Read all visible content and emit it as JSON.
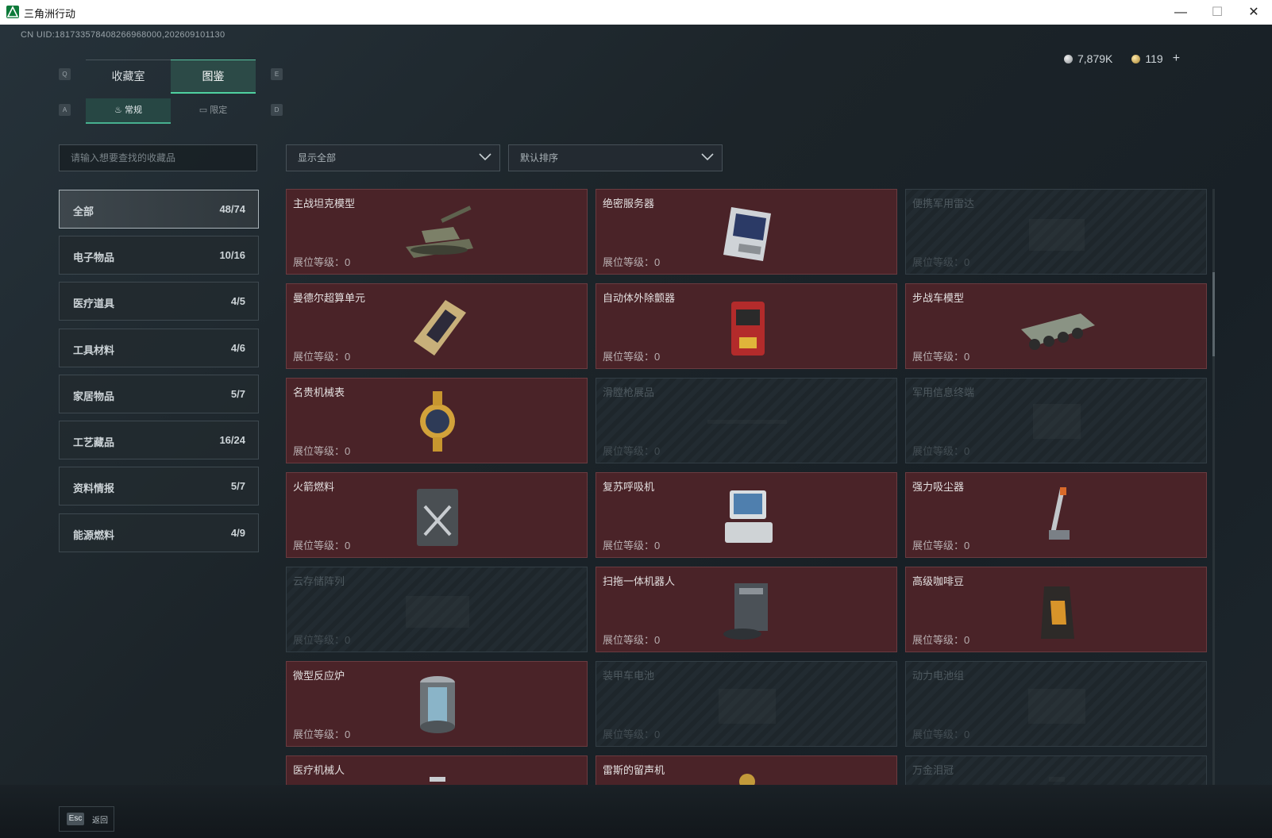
{
  "window": {
    "title": "三角洲行动",
    "min": "—",
    "max": "☐",
    "close": "✕"
  },
  "uid": "CN UID:181733578408266968000,202609101130",
  "currency": {
    "silver": "7,879K",
    "gold": "119",
    "plus": "+"
  },
  "tabs": {
    "key_left": "Q",
    "key_right": "E",
    "collection": "收藏室",
    "atlas": "图鉴"
  },
  "subtabs": {
    "key_left": "A",
    "key_right": "D",
    "normal": "常规",
    "limited": "限定"
  },
  "search": {
    "placeholder": "请输入想要查找的收藏品"
  },
  "filters": {
    "show": "显示全部",
    "sort": "默认排序"
  },
  "categories": [
    {
      "label": "全部",
      "count": "48/74"
    },
    {
      "label": "电子物品",
      "count": "10/16"
    },
    {
      "label": "医疗道具",
      "count": "4/5"
    },
    {
      "label": "工具材料",
      "count": "4/6"
    },
    {
      "label": "家居物品",
      "count": "5/7"
    },
    {
      "label": "工艺藏品",
      "count": "16/24"
    },
    {
      "label": "资料情报",
      "count": "5/7"
    },
    {
      "label": "能源燃料",
      "count": "4/9"
    }
  ],
  "level_label": "展位等级：",
  "level_value": "0",
  "items": [
    {
      "name": "主战坦克模型",
      "owned": true,
      "icon": "tank-icon"
    },
    {
      "name": "绝密服务器",
      "owned": true,
      "icon": "server-icon"
    },
    {
      "name": "便携军用雷达",
      "owned": false,
      "icon": "radar-icon"
    },
    {
      "name": "曼德尔超算单元",
      "owned": true,
      "icon": "chip-icon"
    },
    {
      "name": "自动体外除颤器",
      "owned": true,
      "icon": "defibrillator-icon"
    },
    {
      "name": "步战车模型",
      "owned": true,
      "icon": "ifv-icon"
    },
    {
      "name": "名贵机械表",
      "owned": true,
      "icon": "watch-icon"
    },
    {
      "name": "滑膛枪展品",
      "owned": false,
      "icon": "musket-icon"
    },
    {
      "name": "军用信息终端",
      "owned": false,
      "icon": "terminal-icon"
    },
    {
      "name": "火箭燃料",
      "owned": true,
      "icon": "fuel-can-icon"
    },
    {
      "name": "复苏呼吸机",
      "owned": true,
      "icon": "ventilator-icon"
    },
    {
      "name": "强力吸尘器",
      "owned": true,
      "icon": "vacuum-icon"
    },
    {
      "name": "云存储阵列",
      "owned": false,
      "icon": "storage-array-icon"
    },
    {
      "name": "扫拖一体机器人",
      "owned": true,
      "icon": "robot-vacuum-icon"
    },
    {
      "name": "高级咖啡豆",
      "owned": true,
      "icon": "coffee-bag-icon"
    },
    {
      "name": "微型反应炉",
      "owned": true,
      "icon": "reactor-icon"
    },
    {
      "name": "装甲车电池",
      "owned": false,
      "icon": "battery-icon"
    },
    {
      "name": "动力电池组",
      "owned": false,
      "icon": "battery-pack-icon"
    },
    {
      "name": "医疗机械人",
      "owned": true,
      "icon": "medical-robot-icon"
    },
    {
      "name": "雷斯的留声机",
      "owned": true,
      "icon": "gramophone-icon"
    },
    {
      "name": "万金泪冠",
      "owned": false,
      "icon": "crown-icon"
    }
  ],
  "bottom": {
    "esc_key": "Esc",
    "esc_label": "返回"
  },
  "colors": {
    "accent": "#4fd1a0",
    "owned_card": "#4a2328",
    "locked_card": "#222b31"
  }
}
